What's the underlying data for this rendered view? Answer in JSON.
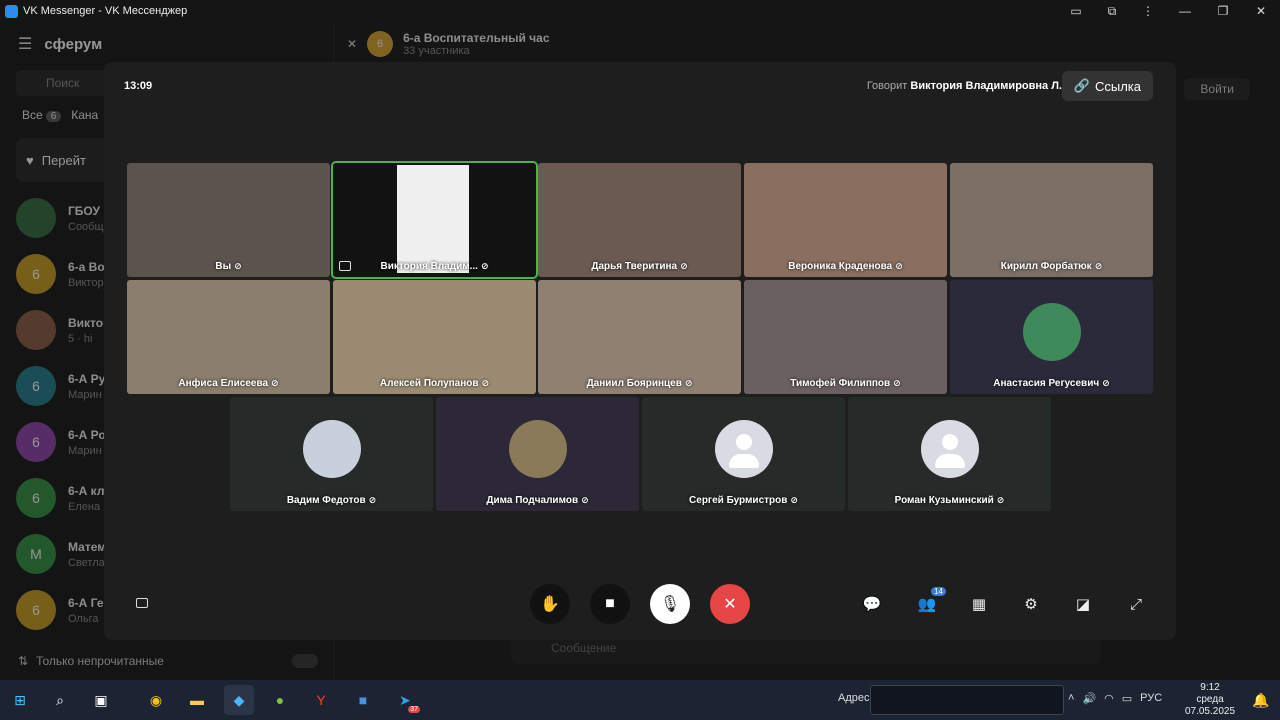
{
  "window": {
    "title": "VK Messenger - VK Мессенджер"
  },
  "sidebar": {
    "logo": "сферум",
    "search_placeholder": "Поиск",
    "tabs": [
      {
        "label": "Все",
        "badge": "6"
      },
      {
        "label": "Кана"
      }
    ],
    "banner": "Перейт",
    "chats": [
      {
        "title": "ГБОУ",
        "subtitle": "Сообщ",
        "avatar": "",
        "color": "#2e6b3a"
      },
      {
        "title": "6-а Во",
        "subtitle": "Виктор",
        "avatar": "6",
        "color": "#c79a1c"
      },
      {
        "title": "Виктор",
        "subtitle": "5 · hi",
        "avatar": "",
        "color": "#8a5a40"
      },
      {
        "title": "6-А Ру",
        "subtitle": "Марин",
        "avatar": "6",
        "color": "#1f7a8c"
      },
      {
        "title": "6-А Ро",
        "subtitle": "Марин",
        "avatar": "6",
        "color": "#8e3ea8"
      },
      {
        "title": "6-А кл",
        "subtitle": "Елена",
        "avatar": "6",
        "color": "#2f8f3e"
      },
      {
        "title": "Матем",
        "subtitle": "Светла",
        "avatar": "М",
        "color": "#2f8f3e"
      },
      {
        "title": "6-А Ге",
        "subtitle": "Ольга",
        "avatar": "6",
        "color": "#c79a1c"
      }
    ],
    "footer_label": "Только непрочитанные"
  },
  "chat_header": {
    "avatar": "6",
    "title": "6-а Воспитательный час",
    "subtitle": "33 участника",
    "join_label": "Войти"
  },
  "composer": {
    "placeholder": "Сообщение"
  },
  "call": {
    "time": "13:09",
    "speaker_prefix": "Говорит",
    "speaker_name": "Виктория Владимировна Л.",
    "link_label": "Ссылка",
    "participants_badge": "14",
    "tiles": [
      {
        "name": "Вы",
        "bg": "#5b544c"
      },
      {
        "name": "Виктория Владим...",
        "bg": "#121212",
        "active": true
      },
      {
        "name": "Дарья Тверитина",
        "bg": "#6a5a52"
      },
      {
        "name": "Вероника Краденова",
        "bg": "#8a6e60"
      },
      {
        "name": "Кирилл Форбатюк",
        "bg": "#7c6f66"
      },
      {
        "name": "Анфиса Елисеева",
        "bg": "#8a7f6c"
      },
      {
        "name": "Алексей Полупанов",
        "bg": "#9b8b72"
      },
      {
        "name": "Даниил Бояринцев",
        "bg": "#8f8072"
      },
      {
        "name": "Тимофей Филиппов",
        "bg": "#6b6060"
      },
      {
        "name": "Анастасия Регусевич",
        "bg": "#2b2a3a"
      },
      {
        "name": "Вадим Федотов",
        "bg": "#262a28"
      },
      {
        "name": "Дима Подчалимов",
        "bg": "#2c2838"
      },
      {
        "name": "Сергей Бурмистров",
        "bg": "#262a28"
      },
      {
        "name": "Роман Кузьминский",
        "bg": "#262a28"
      }
    ]
  },
  "taskbar": {
    "address_label": "Адрес",
    "telegram_badge": "37",
    "language": "РУС",
    "time": "9:12",
    "weekday": "среда",
    "date": "07.05.2025"
  }
}
